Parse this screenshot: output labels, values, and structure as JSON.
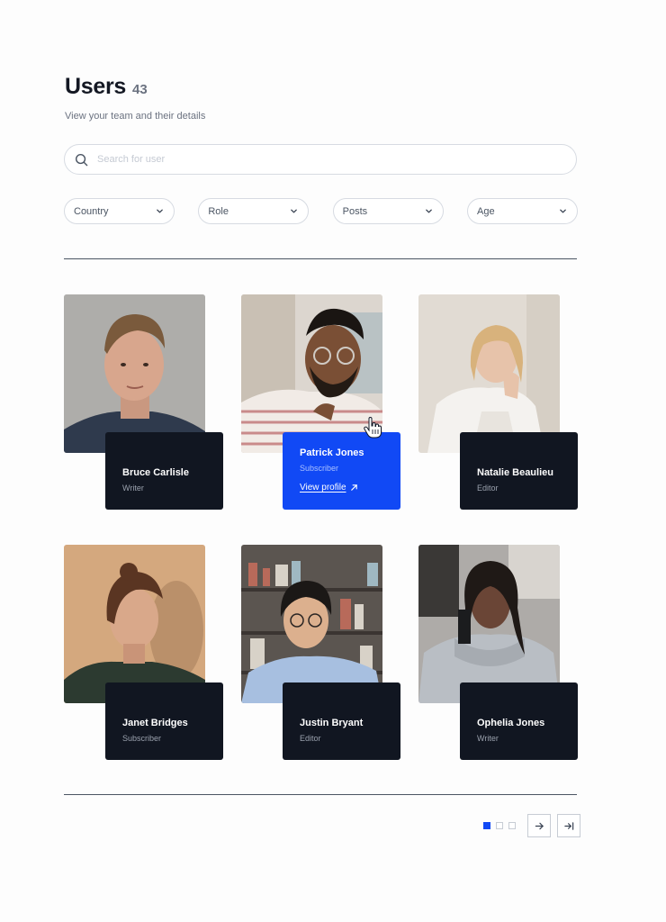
{
  "header": {
    "title": "Users",
    "count": "43",
    "subtitle": "View your team and their details"
  },
  "search": {
    "placeholder": "Search for user",
    "icon": "search-icon"
  },
  "filters": [
    {
      "label": "Country",
      "icon": "chevron-down-icon"
    },
    {
      "label": "Role",
      "icon": "chevron-down-icon"
    },
    {
      "label": "Posts",
      "icon": "chevron-down-icon"
    },
    {
      "label": "Age",
      "icon": "chevron-down-icon"
    }
  ],
  "users": [
    {
      "name": "Bruce Carlisle",
      "role": "Writer"
    },
    {
      "name": "Patrick Jones",
      "role": "Subscriber",
      "link": "View profile",
      "active": true
    },
    {
      "name": "Natalie Beaulieu",
      "role": "Editor"
    },
    {
      "name": "Janet Bridges",
      "role": "Subscriber"
    },
    {
      "name": "Justin Bryant",
      "role": "Editor"
    },
    {
      "name": "Ophelia Jones",
      "role": "Writer"
    }
  ],
  "pagination": {
    "pages": 3,
    "current": 1,
    "next_icon": "arrow-right-icon",
    "last_icon": "arrow-to-end-icon"
  },
  "colors": {
    "accent": "#1149f5",
    "panel_dark": "#111621",
    "text_muted": "#6b7280"
  }
}
